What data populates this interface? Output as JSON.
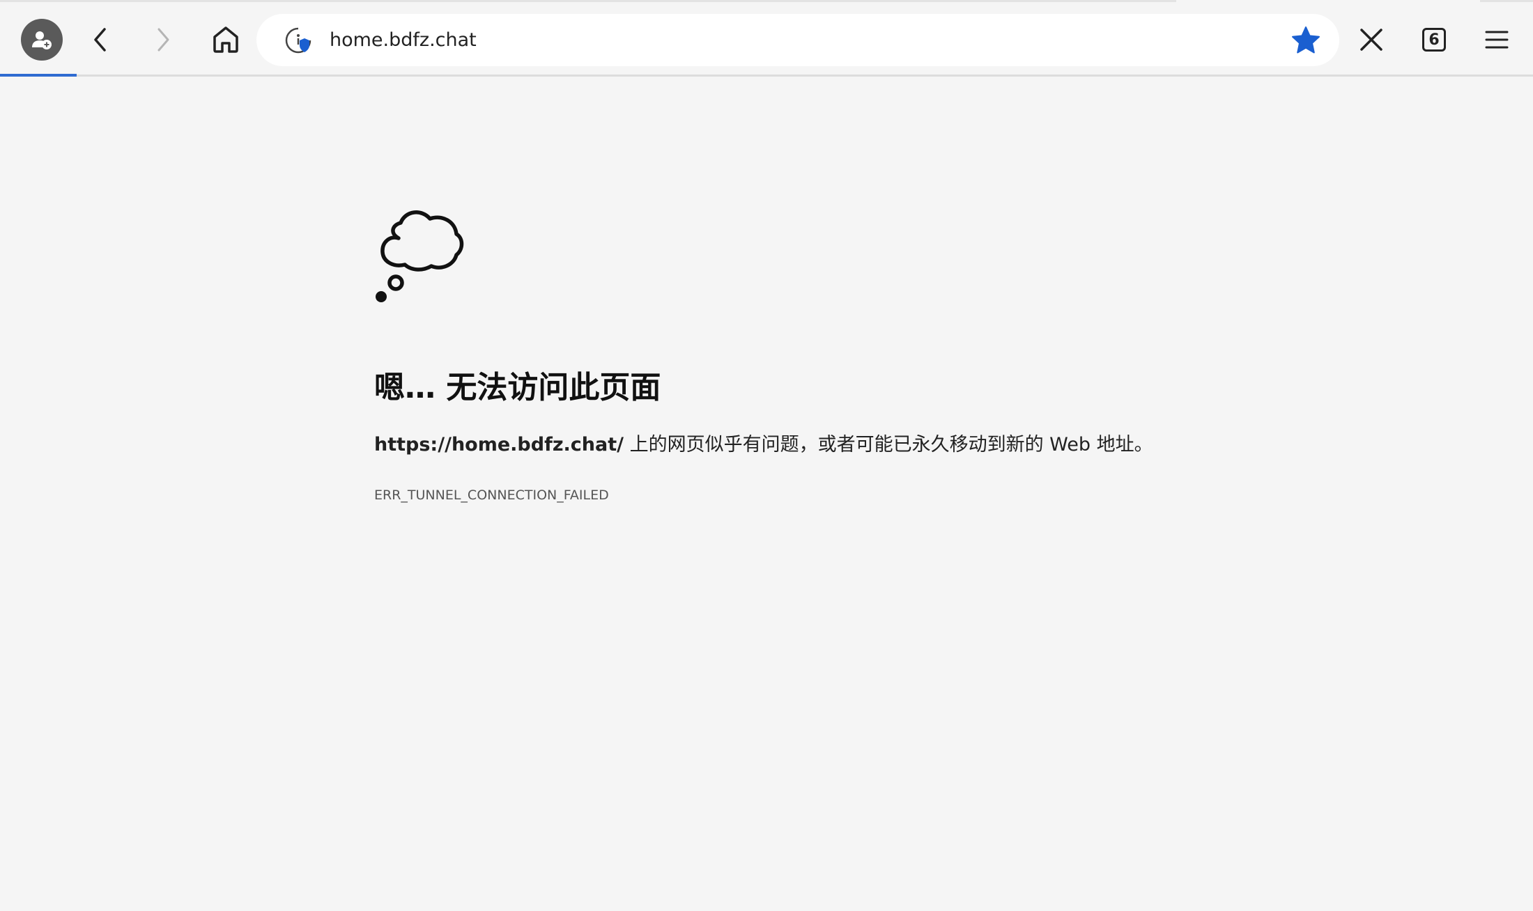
{
  "browser": {
    "address_bar": {
      "url": "home.bdfz.chat",
      "site_info_icon": "site-info-shield-icon",
      "bookmark_icon": "star-filled-icon",
      "bookmarked": true
    },
    "toolbar": {
      "profile_icon": "guest-profile-icon",
      "back_icon": "chevron-left-icon",
      "forward_icon": "chevron-right-icon",
      "home_icon": "home-icon",
      "stop_icon": "close-icon",
      "tab_count": "6",
      "menu_icon": "hamburger-menu-icon"
    }
  },
  "error_page": {
    "icon": "thought-cloud-icon",
    "title": "嗯… 无法访问此页面",
    "url": "https://home.bdfz.chat/",
    "description": " 上的网页似乎有问题，或者可能已永久移动到新的 Web 地址。",
    "error_code": "ERR_TUNNEL_CONNECTION_FAILED"
  },
  "colors": {
    "background": "#f5f5f5",
    "accent_blue": "#1a5fd0",
    "progress_blue": "#2f6bd1"
  }
}
